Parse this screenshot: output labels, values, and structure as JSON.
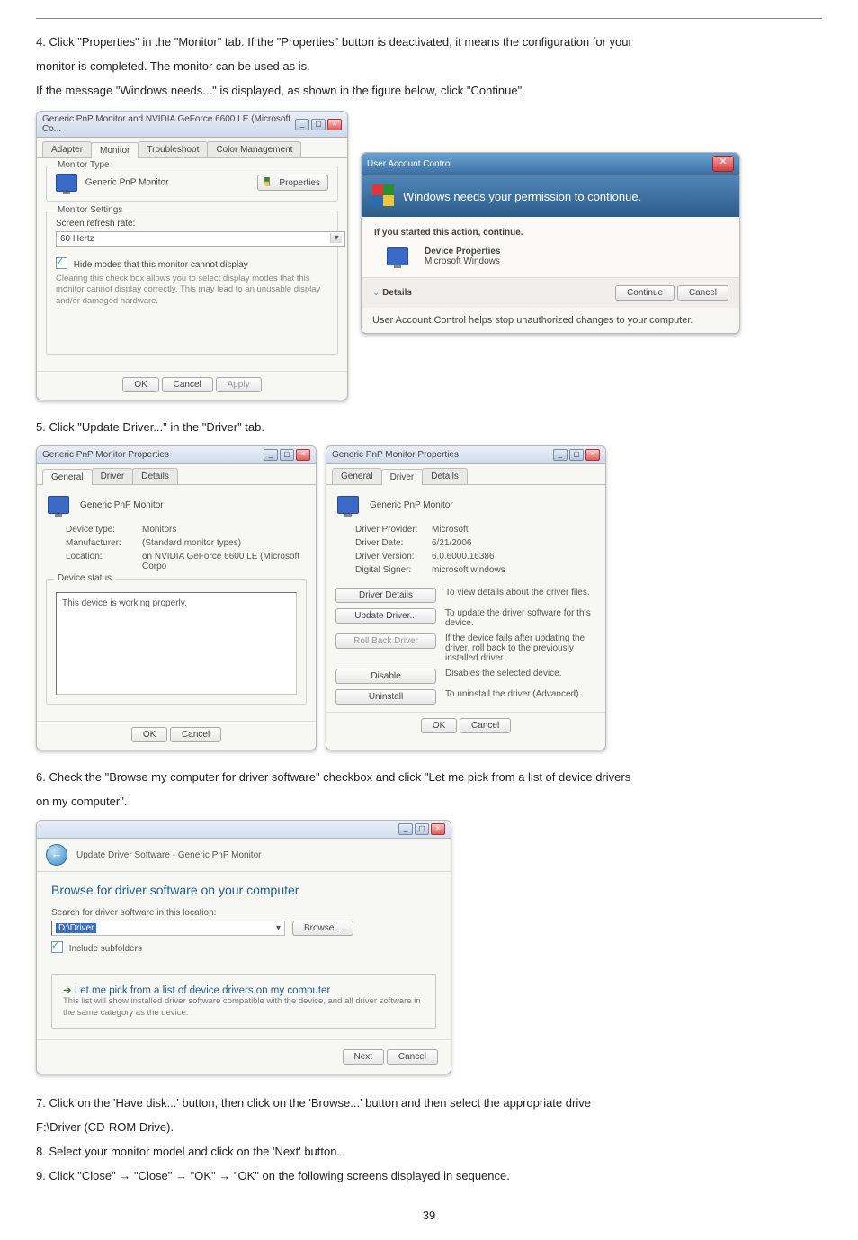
{
  "step4": {
    "text_a": "4. Click \"Properties\" in the \"Monitor\" tab. If the \"Properties\" button is deactivated, it means the configuration for your",
    "text_b": "monitor is completed. The monitor can be used as is.",
    "text_c": "If the message \"Windows needs...\" is displayed, as shown in the figure below, click \"Continue\"."
  },
  "monitor_win": {
    "title": "Generic PnP Monitor and NVIDIA GeForce 6600 LE (Microsoft Co...",
    "tabs": {
      "adapter": "Adapter",
      "monitor": "Monitor",
      "troubleshoot": "Troubleshoot",
      "color": "Color Management"
    },
    "type_legend": "Monitor Type",
    "type_value": "Generic PnP Monitor",
    "properties_btn": "Properties",
    "settings_legend": "Monitor Settings",
    "refresh_label": "Screen refresh rate:",
    "refresh_value": "60 Hertz",
    "hide_modes": "Hide modes that this monitor cannot display",
    "hide_desc": "Clearing this check box allows you to select display modes that this monitor cannot display correctly. This may lead to an unusable display and/or damaged hardware.",
    "ok": "OK",
    "cancel": "Cancel",
    "apply": "Apply"
  },
  "uac": {
    "title": "User Account Control",
    "banner": "Windows needs your permission to contionue.",
    "started": "If you started this action, continue.",
    "dev_prop": "Device Properties",
    "ms_win": "Microsoft Windows",
    "details": "Details",
    "continue": "Continue",
    "cancel": "Cancel",
    "footer": "User Account Control helps stop unauthorized changes to your computer."
  },
  "step5": {
    "text": "5. Click \"Update Driver...\" in the \"Driver\" tab."
  },
  "prop_general": {
    "title": "Generic PnP Monitor Properties",
    "tab_general": "General",
    "tab_driver": "Driver",
    "tab_details": "Details",
    "name": "Generic PnP Monitor",
    "kv": {
      "devtype_l": "Device type:",
      "devtype_v": "Monitors",
      "mfr_l": "Manufacturer:",
      "mfr_v": "(Standard monitor types)",
      "loc_l": "Location:",
      "loc_v": "on NVIDIA GeForce 6600 LE (Microsoft Corpo"
    },
    "status_legend": "Device status",
    "status_text": "This device is working properly.",
    "ok": "OK",
    "cancel": "Cancel"
  },
  "prop_driver": {
    "title": "Generic PnP Monitor Properties",
    "name": "Generic PnP Monitor",
    "kv": {
      "prov_l": "Driver Provider:",
      "prov_v": "Microsoft",
      "date_l": "Driver Date:",
      "date_v": "6/21/2006",
      "ver_l": "Driver Version:",
      "ver_v": "6.0.6000.16386",
      "sign_l": "Digital Signer:",
      "sign_v": "microsoft windows"
    },
    "buttons": {
      "details": "Driver Details",
      "details_d": "To view details about the driver files.",
      "update": "Update Driver...",
      "update_d": "To update the driver software for this device.",
      "rollback": "Roll Back Driver",
      "rollback_d": "If the device fails after updating the driver, roll back to the previously installed driver.",
      "disable": "Disable",
      "disable_d": "Disables the selected device.",
      "uninstall": "Uninstall",
      "uninstall_d": "To uninstall the driver (Advanced)."
    },
    "ok": "OK",
    "cancel": "Cancel"
  },
  "step6": {
    "text_a": "6. Check the \"Browse my computer for driver software\" checkbox and click \"Let me pick from a list of device drivers",
    "text_b": "on my computer\"."
  },
  "wizard": {
    "breadcrumb": "Update Driver Software - Generic PnP Monitor",
    "heading": "Browse for driver software on your computer",
    "search_label": "Search for driver software in this location:",
    "search_value": "D:\\Driver",
    "browse": "Browse...",
    "include": "Include subfolders",
    "pick_title": "Let me pick from a list of device drivers on my computer",
    "pick_sub": "This list will show installed driver software compatible with the device, and all driver software in the same category as the device.",
    "next": "Next",
    "cancel": "Cancel"
  },
  "step7": {
    "text_a": "7. Click on the 'Have disk...' button, then click on the 'Browse...' button and then select the appropriate drive",
    "text_b": "F:\\Driver (CD-ROM Drive)."
  },
  "step8": {
    "text": "8. Select your monitor model and click on the 'Next' button."
  },
  "step9": {
    "pre": "9. Click \"Close\" ",
    "a": " \"Close\" ",
    "b": " \"OK\" ",
    "c": " \"OK\" on the following screens displayed in sequence."
  },
  "pagenum": "39"
}
